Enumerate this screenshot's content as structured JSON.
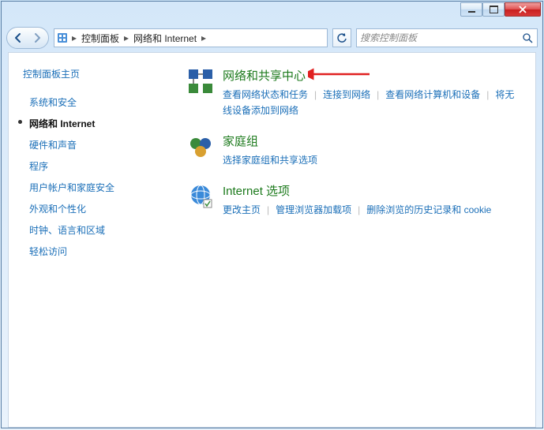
{
  "titlebar": {},
  "address": {
    "segments": [
      "控制面板",
      "网络和 Internet"
    ],
    "search_placeholder": "搜索控制面板"
  },
  "sidebar": {
    "home": "控制面板主页",
    "items": [
      {
        "label": "系统和安全",
        "current": false
      },
      {
        "label": "网络和 Internet",
        "current": true
      },
      {
        "label": "硬件和声音",
        "current": false
      },
      {
        "label": "程序",
        "current": false
      },
      {
        "label": "用户帐户和家庭安全",
        "current": false
      },
      {
        "label": "外观和个性化",
        "current": false
      },
      {
        "label": "时钟、语言和区域",
        "current": false
      },
      {
        "label": "轻松访问",
        "current": false
      }
    ]
  },
  "categories": [
    {
      "id": "network-sharing",
      "title": "网络和共享中心",
      "links": [
        "查看网络状态和任务",
        "连接到网络",
        "查看网络计算机和设备",
        "将无线设备添加到网络"
      ]
    },
    {
      "id": "homegroup",
      "title": "家庭组",
      "links": [
        "选择家庭组和共享选项"
      ]
    },
    {
      "id": "internet-options",
      "title": "Internet 选项",
      "links": [
        "更改主页",
        "管理浏览器加载项",
        "删除浏览的历史记录和 cookie"
      ]
    }
  ]
}
